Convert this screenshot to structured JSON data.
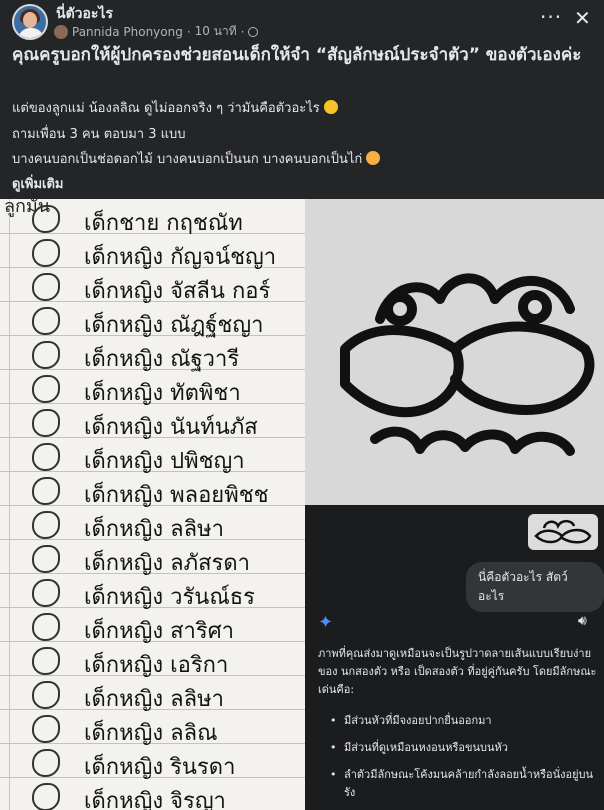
{
  "header": {
    "group_name": "นี่ตัวอะไร",
    "author": "Pannida Phonyong",
    "time": "10 นาที",
    "more_icon": "more-icon",
    "close_icon": "close-icon"
  },
  "post": {
    "title": "คุณครูบอกให้ผู้ปกครองช่วยสอนเด็กให้จำ “สัญลักษณ์ประจำตัว” ของตัวเองค่ะ",
    "lines": [
      "แต่ของลูกแม่ น้องลลิณ ดูไม่ออกจริง ๆ ว่ามันคือตัวอะไร",
      "ถามเพื่อน 3 คน ตอบมา 3 แบบ",
      "บางคนบอกเป็นช่อดอกไม้ บางคนบอกเป็นนก บางคนบอกเป็นไก่"
    ],
    "see_more": "ดูเพิ่มเติม"
  },
  "photo": {
    "heading_fragment": "ลูกมัน",
    "names": [
      "เด็กชาย กฤชณัท",
      "เด็กหญิง กัญจน์ชญา",
      "เด็กหญิง จัสลีน กอร์",
      "เด็กหญิง ณัฎฐ์ชญา",
      "เด็กหญิง ณัฐวารี",
      "เด็กหญิง ทัตพิชา",
      "เด็กหญิง นันท์นภัส",
      "เด็กหญิง ปพิชญา",
      "เด็กหญิง พลอยพิชช",
      "เด็กหญิง ลลิษา",
      "เด็กหญิง ลภัสรดา",
      "เด็กหญิง วรันณ์ธร",
      "เด็กหญิง สาริศา",
      "เด็กหญิง เอริกา",
      "เด็กหญิง ลลิษา",
      "เด็กหญิง ลลิณ",
      "เด็กหญิง รินรดา",
      "เด็กหญิง จิรญา"
    ]
  },
  "chat": {
    "user_message": "นี่คือตัวอะไร สัตว์อะไร",
    "ai_reply": "ภาพที่คุณส่งมาดูเหมือนจะเป็นรูปวาดลายเส้นแบบเรียบง่ายของ นกสองตัว หรือ เป็ดสองตัว ที่อยู่คู่กันครับ โดยมีลักษณะเด่นคือ:",
    "bullets": [
      "มีส่วนหัวที่มีจงอยปากยื่นออกมา",
      "มีส่วนที่ดูเหมือนหงอนหรือขนบนหัว",
      "ลำตัวมีลักษณะโค้งมนคล้ายกำลังลอยน้ำหรือนั่งอยู่บนรัง"
    ],
    "spark_icon": "sparkle-icon",
    "speaker_icon": "speaker-icon"
  },
  "colors": {
    "background": "#242526",
    "text": "#e4e6eb",
    "muted": "#b0b3b8",
    "accent": "#4c8df6"
  }
}
